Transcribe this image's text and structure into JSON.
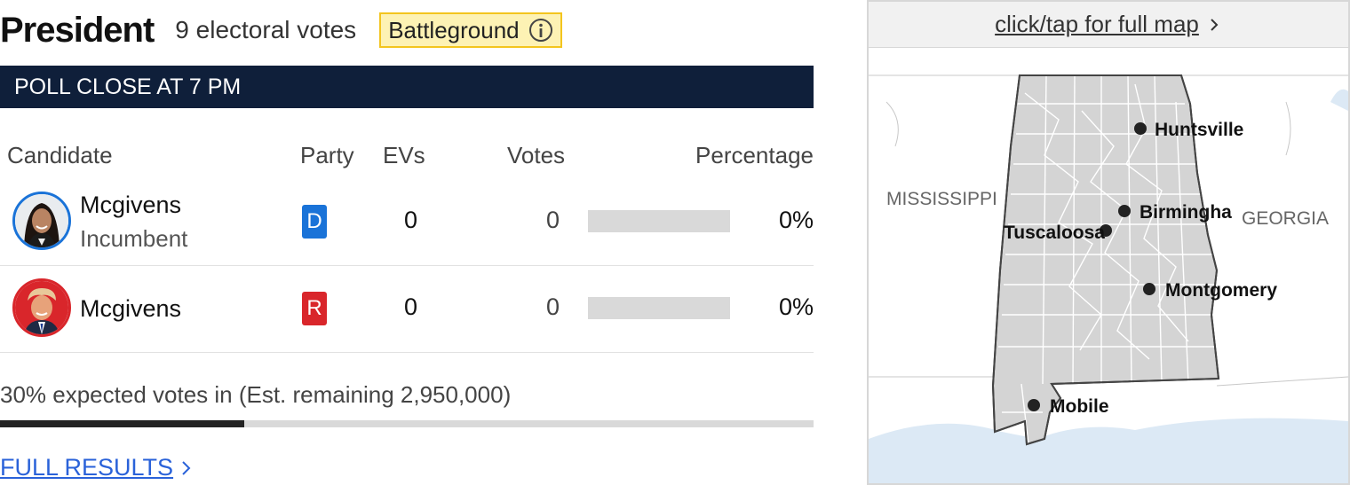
{
  "race": {
    "title": "President",
    "electoral_votes_text": "9 electoral votes",
    "badge_label": "Battleground",
    "badge_icon": "info-icon",
    "poll_close": "POLL CLOSE AT 7 PM"
  },
  "table": {
    "headers": {
      "candidate": "Candidate",
      "party": "Party",
      "evs": "EVs",
      "votes": "Votes",
      "percentage": "Percentage"
    },
    "rows": [
      {
        "name": "Mcgivens",
        "status": "Incumbent",
        "party": "D",
        "party_color": "#1a73d8",
        "evs": "0",
        "votes": "0",
        "percentage": "0%",
        "pct_value": 0
      },
      {
        "name": "Mcgivens",
        "status": "",
        "party": "R",
        "party_color": "#d9262b",
        "evs": "0",
        "votes": "0",
        "percentage": "0%",
        "pct_value": 0
      }
    ]
  },
  "progress": {
    "expected_text": "30% expected votes in (Est. remaining 2,950,000)",
    "fraction": 0.3
  },
  "full_results_label": "FULL RESULTS",
  "map": {
    "header_label": "click/tap for full map",
    "header_icon": "chevron-right-icon",
    "states": {
      "west": "MISSISSIPPI",
      "east": "GEORGIA"
    },
    "cities": [
      "Huntsville",
      "Birmingha",
      "Tuscaloosa",
      "Montgomery",
      "Mobile"
    ]
  },
  "colors": {
    "navy": "#0f1f3a",
    "badge_bg": "#fdf2b4",
    "badge_border": "#f3c51e",
    "link": "#2a62d9",
    "map_fill": "#d4d4d4",
    "water": "#dce9f5"
  }
}
